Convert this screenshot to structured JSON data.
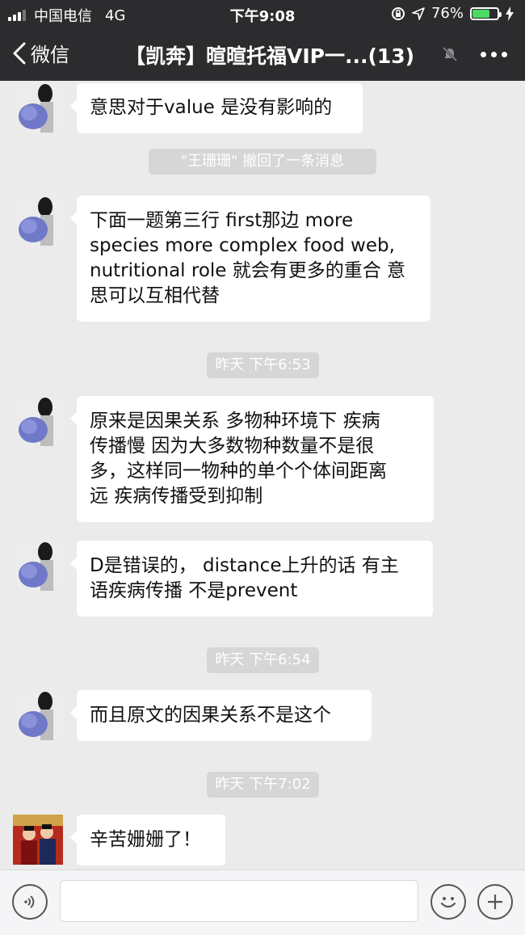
{
  "status_bar": {
    "carrier": "中国电信",
    "network": "4G",
    "time": "下午9:08",
    "battery_percent": "76%",
    "battery_level": 0.76
  },
  "nav": {
    "back_label": "微信",
    "title": "【凯奔】暄暄托福VIP一...(13)"
  },
  "messages": [
    {
      "text_lines": [
        "意思对于value 是没有影响的"
      ]
    },
    {
      "system": "\"王珊珊\" 撤回了一条消息"
    },
    {
      "text_lines": [
        "下面一题第三行 first那边 more",
        "species  more complex food web,",
        "nutritional role 就会有更多的重合 意",
        "思可以互相代替"
      ]
    },
    {
      "system": "昨天 下午6:53"
    },
    {
      "text_lines": [
        "原来是因果关系 多物种环境下 疾病",
        "传播慢 因为大多数物种数量不是很",
        "多，这样同一物种的单个个体间距离",
        "远 疾病传播受到抑制"
      ]
    },
    {
      "text_lines": [
        "D是错误的，  distance上升的话 有主",
        "语疾病传播 不是prevent"
      ]
    },
    {
      "system": "昨天 下午6:54"
    },
    {
      "text_lines": [
        "而且原文的因果关系不是这个"
      ]
    },
    {
      "system": "昨天 下午7:02"
    },
    {
      "text_lines": [
        "辛苦姗姗了！"
      ]
    }
  ],
  "colors": {
    "header_bg": "#2c2c2e",
    "chat_bg": "#ebebeb",
    "bubble_bg": "#ffffff",
    "system_pill": "#d6d6d6",
    "battery_green": "#4cd964"
  }
}
